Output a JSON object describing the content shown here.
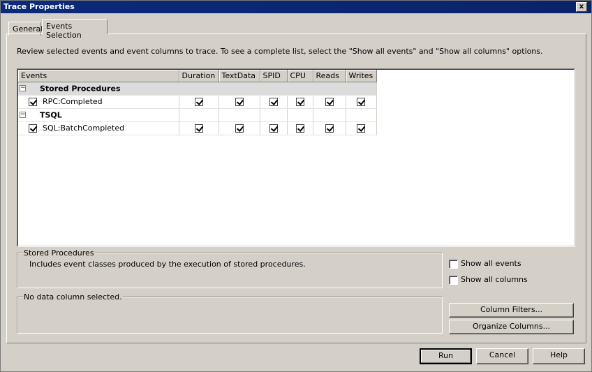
{
  "window": {
    "title": "Trace Properties",
    "close_glyph": "x"
  },
  "tabs": [
    {
      "label": "General"
    },
    {
      "label": "Events Selection",
      "active": true
    }
  ],
  "intro_text": "Review selected events and event columns to trace. To see a complete list, select the \"Show all events\" and \"Show all columns\" options.",
  "grid": {
    "headers": [
      "Events",
      "Duration",
      "TextData",
      "SPID",
      "CPU",
      "Reads",
      "Writes"
    ],
    "rows": [
      {
        "type": "category",
        "label": "Stored Procedures",
        "expander": "−"
      },
      {
        "type": "event",
        "label": "RPC:Completed",
        "checked": true,
        "columns": [
          true,
          true,
          true,
          true,
          true,
          true
        ]
      },
      {
        "type": "category",
        "label": "TSQL",
        "expander": "−"
      },
      {
        "type": "event",
        "label": "SQL:BatchCompleted",
        "checked": true,
        "columns": [
          true,
          true,
          true,
          true,
          true,
          true
        ]
      }
    ]
  },
  "description_box": {
    "legend": "Stored Procedures",
    "text": "Includes event classes produced by the execution of stored procedures."
  },
  "datacolumn_box": {
    "legend": "No data column selected."
  },
  "options": {
    "show_all_events": {
      "label": "Show all events",
      "checked": false
    },
    "show_all_columns": {
      "label": "Show all columns",
      "checked": false
    }
  },
  "buttons": {
    "column_filters": "Column Filters...",
    "organize_columns": "Organize Columns...",
    "run": "Run",
    "cancel": "Cancel",
    "help": "Help"
  }
}
